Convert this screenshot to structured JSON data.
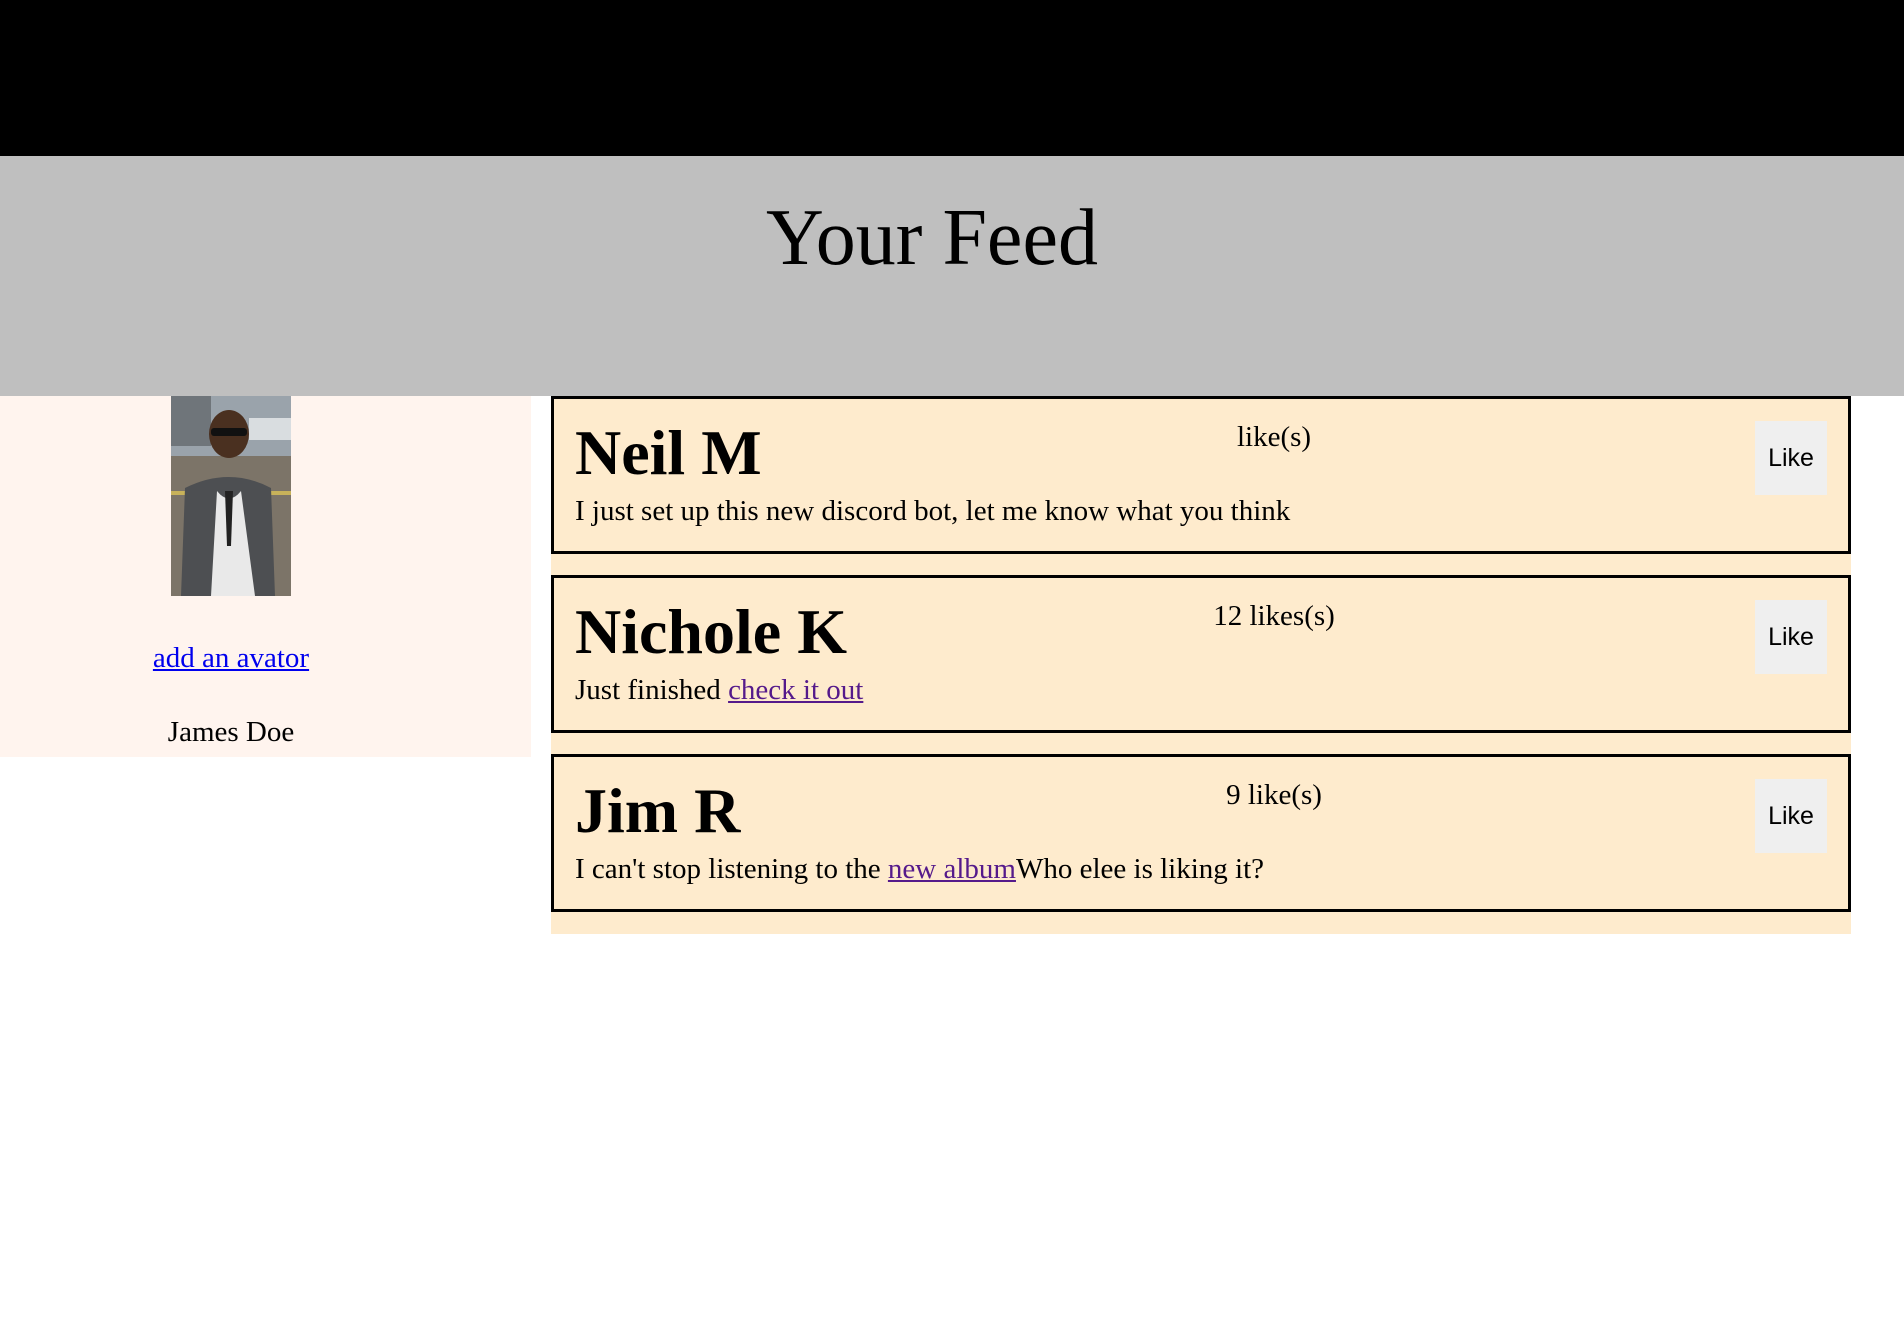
{
  "page": {
    "title": "Your Feed"
  },
  "sidebar": {
    "avatar_link": "add an avator",
    "user_name": "James Doe"
  },
  "posts": [
    {
      "author": "Neil M",
      "likes": "like(s)",
      "body_text": "I just set up this new discord bot, let me know what you think",
      "link_text": "",
      "after_text": "",
      "like_label": "Like"
    },
    {
      "author": "Nichole K",
      "likes": "12 likes(s)",
      "body_text": "Just finished ",
      "link_text": "check it out",
      "after_text": "",
      "like_label": "Like"
    },
    {
      "author": "Jim R",
      "likes": "9 like(s)",
      "body_text": "I can't stop listening to the ",
      "link_text": "new album",
      "after_text": "Who elee is liking it?",
      "like_label": "Like"
    }
  ]
}
